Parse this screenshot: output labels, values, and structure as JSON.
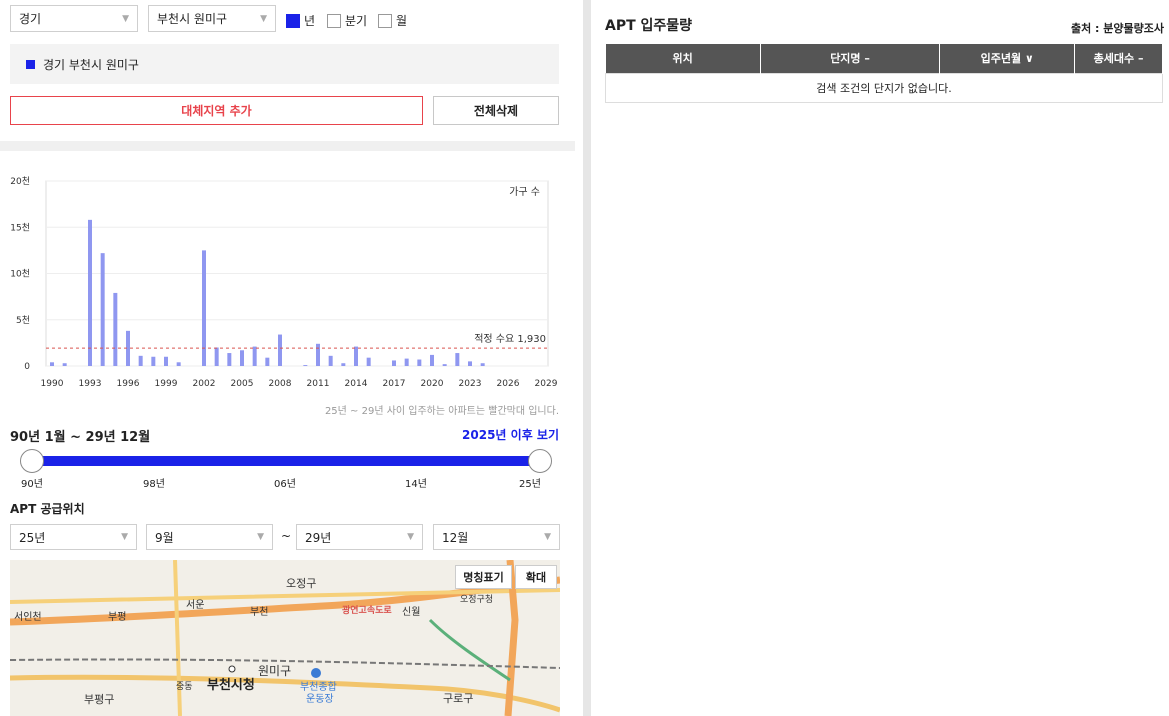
{
  "filters": {
    "province": "경기",
    "city": "부천시 원미구",
    "options": [
      {
        "label": "년",
        "checked": true
      },
      {
        "label": "분기",
        "checked": false
      },
      {
        "label": "월",
        "checked": false
      }
    ]
  },
  "region_item": "경기 부천시 원미구",
  "buttons": {
    "add_region": "대체지역 추가",
    "delete_all": "전체삭제"
  },
  "chart_data": {
    "type": "bar",
    "legend": "가구 수",
    "y_tick_labels": [
      "20천",
      "15천",
      "10천",
      "5천",
      "0"
    ],
    "ylim": [
      0,
      20000
    ],
    "x_tick_labels": [
      "1990",
      "1993",
      "1996",
      "1999",
      "2002",
      "2005",
      "2008",
      "2011",
      "2014",
      "2017",
      "2020",
      "2023",
      "2026",
      "2029"
    ],
    "categories": [
      1990,
      1991,
      1992,
      1993,
      1994,
      1995,
      1996,
      1997,
      1998,
      1999,
      2000,
      2001,
      2002,
      2003,
      2004,
      2005,
      2006,
      2007,
      2008,
      2009,
      2010,
      2011,
      2012,
      2013,
      2014,
      2015,
      2016,
      2017,
      2018,
      2019,
      2020,
      2021,
      2022,
      2023,
      2024,
      2025,
      2026,
      2027,
      2028,
      2029
    ],
    "values": [
      400,
      300,
      0,
      15800,
      12200,
      7900,
      3800,
      1100,
      1000,
      1000,
      400,
      0,
      12500,
      2000,
      1400,
      1700,
      2100,
      900,
      3400,
      0,
      100,
      2400,
      1100,
      300,
      2100,
      900,
      0,
      600,
      800,
      700,
      1200,
      200,
      1400,
      500,
      300,
      0,
      0,
      0,
      0,
      0
    ],
    "reference_label": "적정 수요 1,930",
    "reference_value": 1930,
    "bar_color": "#8f97f0",
    "reference_color": "#d9534f"
  },
  "chart_note": "25년 ~ 29년 사이 입주하는 아파트는 빨간막대 입니다.",
  "range": {
    "label": "90년 1월 ~ 29년 12월",
    "link": "2025년 이후 보기",
    "ticks": [
      "90년",
      "98년",
      "06년",
      "14년",
      "25년"
    ]
  },
  "supply": {
    "title": "APT 공급위치",
    "from_year": "25년",
    "from_month": "9월",
    "tilde": "~",
    "to_year": "29년",
    "to_month": "12월"
  },
  "map": {
    "btn_labels": "명칭표기",
    "btn_zoom": "확대",
    "labels": [
      "오정구",
      "서운",
      "부천",
      "신월",
      "서인천",
      "부평",
      "광연고속도로",
      "원미구",
      "부천시청",
      "부천종합",
      "운동장",
      "부평구",
      "구로구",
      "오정구청",
      "중동"
    ]
  },
  "right": {
    "title": "APT 입주물량",
    "source": "출처 : 분양물량조사",
    "headers": [
      "위치",
      "단지명 –",
      "입주년월 ∨",
      "총세대수 –"
    ],
    "empty": "검색 조건의 단지가 없습니다."
  }
}
